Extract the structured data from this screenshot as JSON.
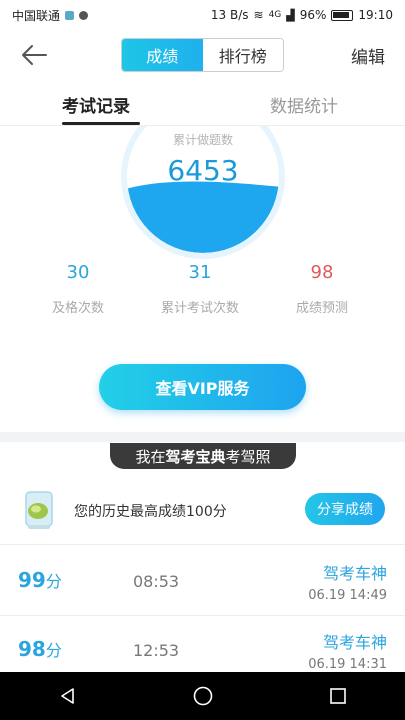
{
  "status_bar": {
    "carrier": "中国联通",
    "speed": "13 B/s",
    "network": "4G",
    "battery": "96%",
    "time": "19:10"
  },
  "header": {
    "back_icon": "arrow-left-icon",
    "segments": [
      "成绩",
      "排行榜"
    ],
    "active_segment": 0,
    "edit_label": "编辑"
  },
  "subtabs": {
    "items": [
      "考试记录",
      "数据统计"
    ],
    "active": 0
  },
  "gauge": {
    "label": "累计做题数",
    "value": "6453",
    "fill_fraction": 0.45,
    "fill_color": "#1ea7ee"
  },
  "stats": [
    {
      "value": "30",
      "label": "及格次数",
      "color": "#2aa5df"
    },
    {
      "value": "31",
      "label": "累计考试次数",
      "color": "#2aa5df"
    },
    {
      "value": "98",
      "label": "成绩预测",
      "color": "#e05a5a"
    }
  ],
  "vip_button": "查看VIP服务",
  "banner": {
    "prefix": "我在",
    "brand": "驾考宝典",
    "suffix": "考驾照"
  },
  "best_score": {
    "icon": "trophy-icon",
    "text": "您的历史最高成绩100分",
    "share_label": "分享成绩"
  },
  "records": [
    {
      "score": "99",
      "unit": "分",
      "duration": "08:53",
      "title": "驾考车神",
      "date": "06.19  14:49"
    },
    {
      "score": "98",
      "unit": "分",
      "duration": "12:53",
      "title": "驾考车神",
      "date": "06.19  14:31"
    }
  ],
  "nav": [
    "back-triangle-icon",
    "home-circle-icon",
    "recent-square-icon"
  ]
}
